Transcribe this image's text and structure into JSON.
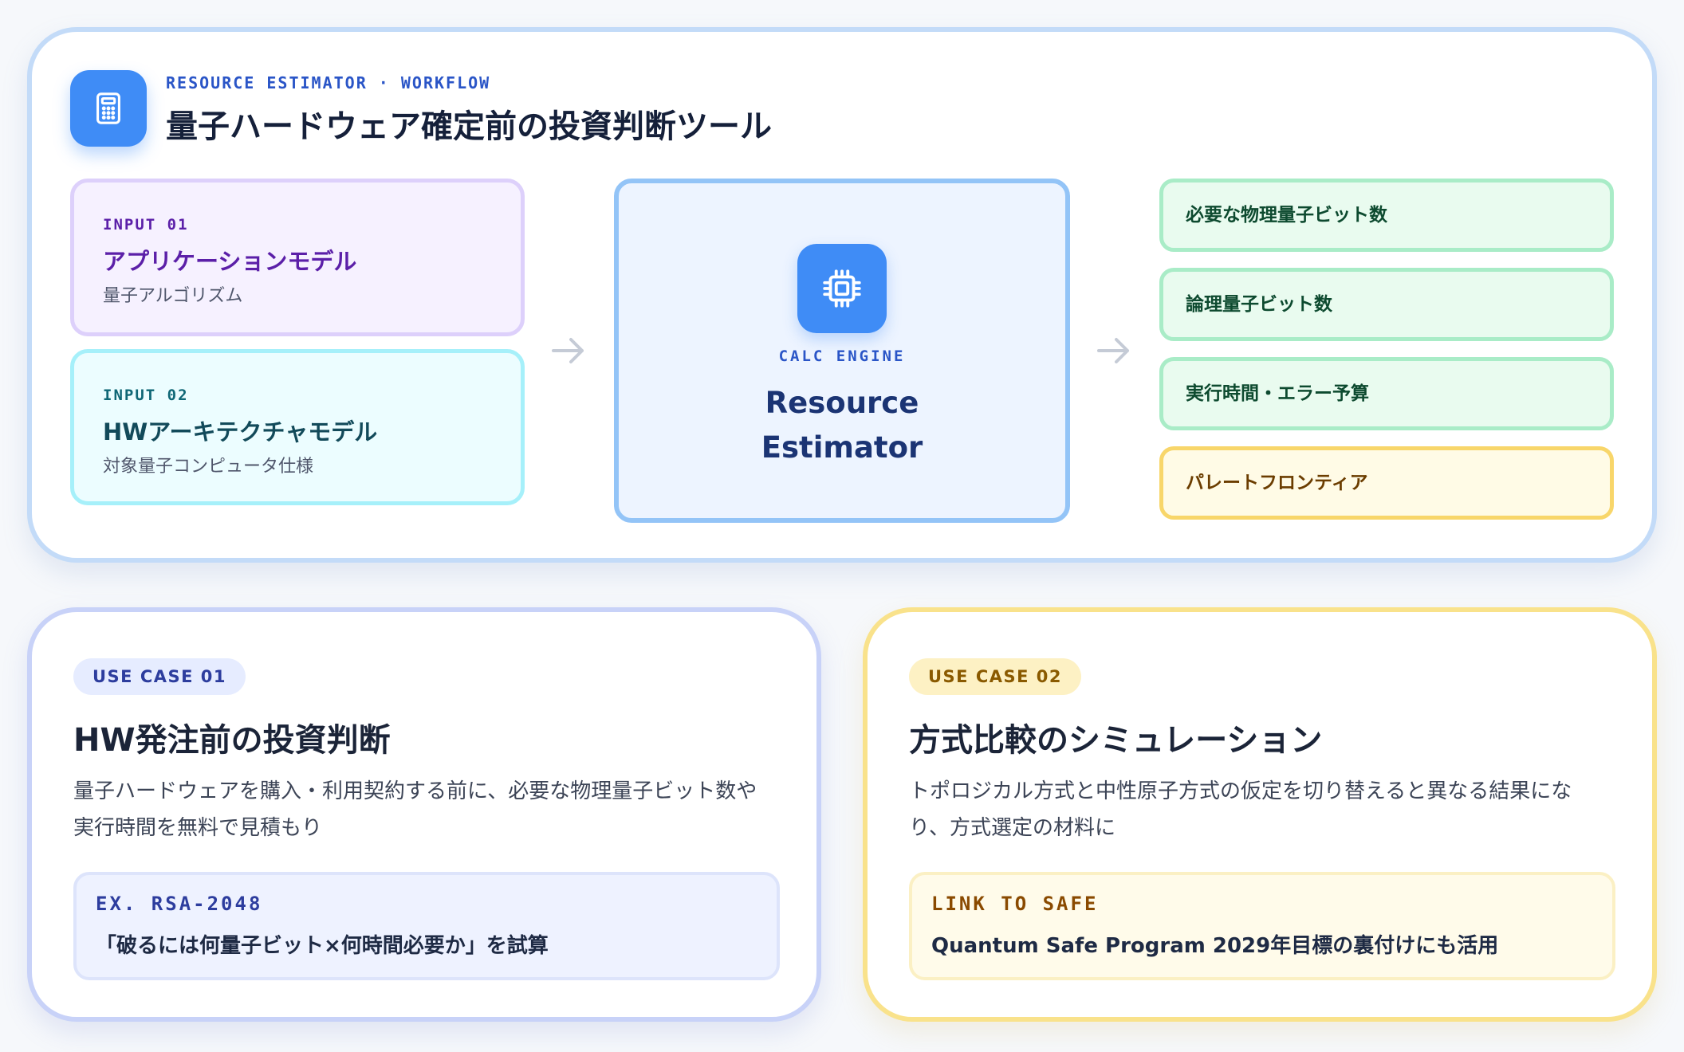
{
  "header": {
    "eyebrow": "RESOURCE ESTIMATOR · WORKFLOW",
    "title": "量子ハードウェア確定前の投資判断ツール"
  },
  "inputs": [
    {
      "tag": "INPUT 01",
      "title": "アプリケーションモデル",
      "subtitle": "量子アルゴリズム"
    },
    {
      "tag": "INPUT 02",
      "title": "HWアーキテクチャモデル",
      "subtitle": "対象量子コンピュータ仕様"
    }
  ],
  "engine": {
    "tag": "CALC ENGINE",
    "name_line1": "Resource",
    "name_line2": "Estimator"
  },
  "outputs": [
    {
      "label": "必要な物理量子ビット数"
    },
    {
      "label": "論理量子ビット数"
    },
    {
      "label": "実行時間・エラー予算"
    },
    {
      "label": "パレートフロンティア"
    }
  ],
  "use_cases": [
    {
      "pill": "USE CASE 01",
      "title": "HW発注前の投資判断",
      "description": "量子ハードウェアを購入・利用契約する前に、必要な物理量子ビット数や実行時間を無料で見積もり",
      "note_tag": "EX. RSA-2048",
      "note_text": "「破るには何量子ビット×何時間必要か」を試算"
    },
    {
      "pill": "USE CASE 02",
      "title": "方式比較のシミュレーション",
      "description": "トポロジカル方式と中性原子方式の仮定を切り替えると異なる結果になり、方式選定の材料に",
      "note_tag": "LINK TO SAFE",
      "note_text": "Quantum Safe Program 2029年目標の裏付けにも活用"
    }
  ],
  "colors": {
    "accent_blue": "#3f8cf6",
    "input1_border": "#ddd0fb",
    "input2_border": "#a6f0fa",
    "output_border": "#a9ecc7",
    "pareto_border": "#f8d66a"
  },
  "icons": {
    "header": "calculator-icon",
    "engine": "cpu-chip-icon",
    "flow": "arrow-right-icon"
  }
}
